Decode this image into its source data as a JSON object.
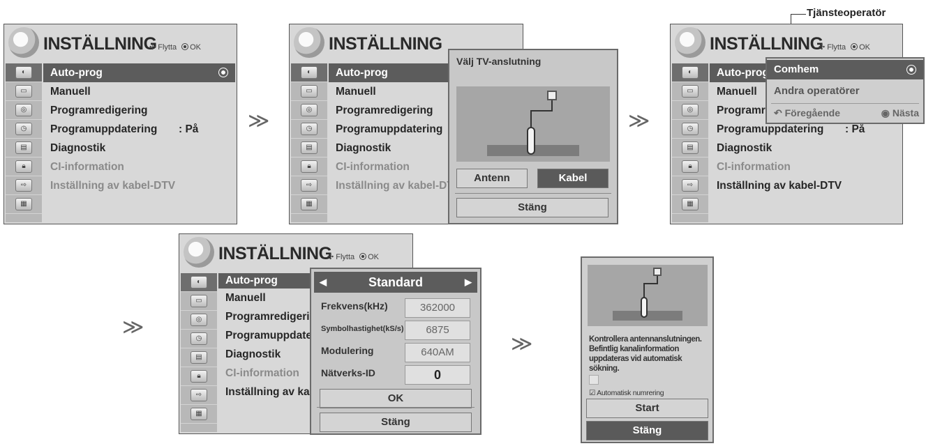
{
  "menu": {
    "title": "INSTÄLLNING",
    "hint_move": "Flytta",
    "hint_ok": "OK",
    "items": [
      "Auto-prog",
      "Manuell",
      "Programredigering",
      "Programuppdatering",
      "Diagnostik",
      "CI-information",
      "Inställning av kabel-DTV"
    ],
    "items_truncated_p4": [
      "Auto-prog",
      "Manuell",
      "Programredigering",
      "Programuppdateri",
      "Diagnostik",
      "CI-information",
      "Inställning av kab"
    ],
    "items_truncated_p3": [
      "Auto-prog",
      "Manuell",
      "Programre"
    ],
    "update_value": ": På",
    "arrow": "≫"
  },
  "panel2": {
    "popup_title": "Välj TV-anslutning",
    "btn_antenna": "Antenn",
    "btn_cable": "Kabel",
    "btn_close": "Stäng"
  },
  "panel3": {
    "callout": "Tjänsteoperatör",
    "operator_selected": "Comhem",
    "operator_other": "Andra operatörer",
    "prev": "Föregående",
    "next": "Nästa"
  },
  "panel4": {
    "mode": "Standard",
    "fields": [
      {
        "label": "Frekvens(kHz)",
        "value": "362000"
      },
      {
        "label": "Symbolhastighet(kS/s)",
        "value": "6875"
      },
      {
        "label": "Modulering",
        "value": "640AM"
      },
      {
        "label": "Nätverks-ID",
        "value": "0"
      }
    ],
    "ok": "OK",
    "close": "Stäng"
  },
  "panel5": {
    "message": "Kontrollera antennanslutningen. Befintlig kanalinformation uppdateras vid automatisk sökning.",
    "checkbox_label": "Automatisk numrering",
    "start": "Start",
    "close": "Stäng"
  }
}
